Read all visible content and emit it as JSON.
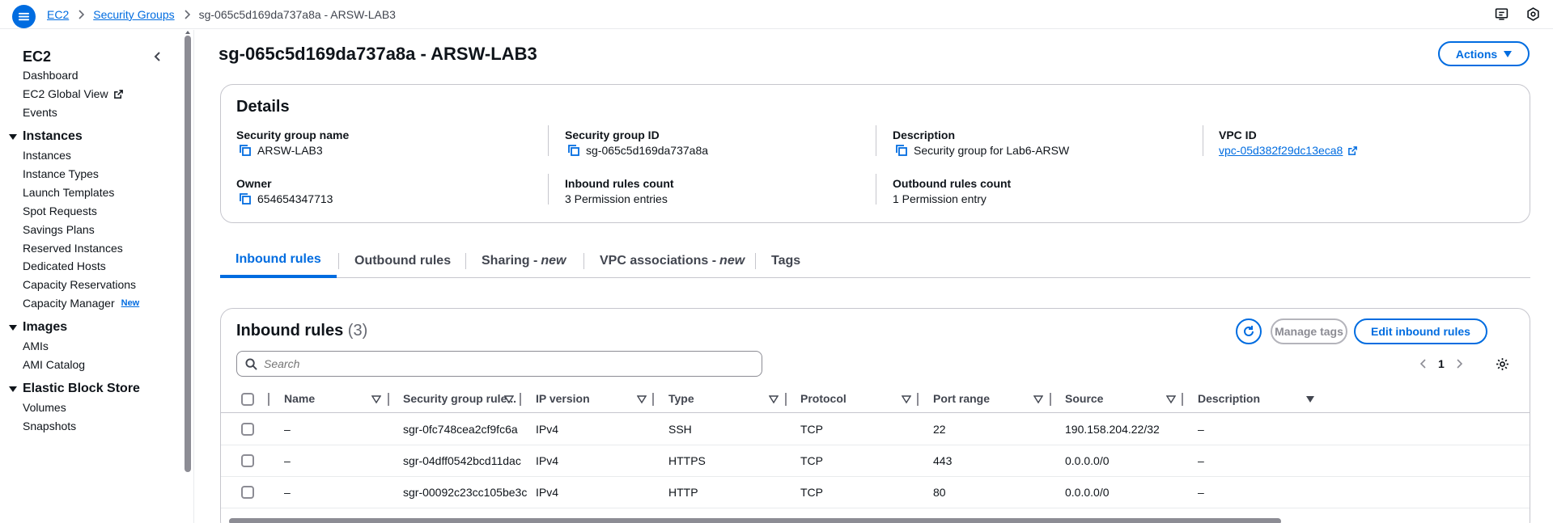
{
  "breadcrumb": {
    "root": "EC2",
    "parent": "Security Groups",
    "current": "sg-065c5d169da737a8a - ARSW-LAB3"
  },
  "sidebar": {
    "title": "EC2",
    "top_items": [
      "Dashboard",
      "EC2 Global View",
      "Events"
    ],
    "sections": [
      {
        "title": "Instances",
        "items": [
          "Instances",
          "Instance Types",
          "Launch Templates",
          "Spot Requests",
          "Savings Plans",
          "Reserved Instances",
          "Dedicated Hosts",
          "Capacity Reservations",
          "Capacity Manager"
        ]
      },
      {
        "title": "Images",
        "items": [
          "AMIs",
          "AMI Catalog"
        ]
      },
      {
        "title": "Elastic Block Store",
        "items": [
          "Volumes",
          "Snapshots"
        ]
      }
    ],
    "new_badge": "New"
  },
  "page": {
    "title": "sg-065c5d169da737a8a - ARSW-LAB3",
    "actions_label": "Actions"
  },
  "details": {
    "heading": "Details",
    "fields": {
      "sg_name": {
        "label": "Security group name",
        "value": "ARSW-LAB3"
      },
      "sg_id": {
        "label": "Security group ID",
        "value": "sg-065c5d169da737a8a"
      },
      "description": {
        "label": "Description",
        "value": "Security group for Lab6-ARSW"
      },
      "vpc_id": {
        "label": "VPC ID",
        "value": "vpc-05d382f29dc13eca8"
      },
      "owner": {
        "label": "Owner",
        "value": "654654347713"
      },
      "inbound_count": {
        "label": "Inbound rules count",
        "value": "3 Permission entries"
      },
      "outbound_count": {
        "label": "Outbound rules count",
        "value": "1 Permission entry"
      }
    }
  },
  "tabs": {
    "inbound": "Inbound rules",
    "outbound": "Outbound rules",
    "sharing": "Sharing -",
    "sharing_new": "new",
    "vpc_assoc": "VPC associations -",
    "vpc_assoc_new": "new",
    "tags": "Tags"
  },
  "rules": {
    "heading": "Inbound rules",
    "count": "(3)",
    "manage_tags": "Manage tags",
    "edit": "Edit inbound rules",
    "search_placeholder": "Search",
    "page": "1",
    "columns": [
      "Name",
      "Security group rule...",
      "IP version",
      "Type",
      "Protocol",
      "Port range",
      "Source",
      "Description"
    ],
    "rows": [
      {
        "name": "–",
        "rule_id": "sgr-0fc748cea2cf9fc6a",
        "ip_version": "IPv4",
        "type": "SSH",
        "protocol": "TCP",
        "port_range": "22",
        "source": "190.158.204.22/32",
        "description": "–"
      },
      {
        "name": "–",
        "rule_id": "sgr-04dff0542bcd11dac",
        "ip_version": "IPv4",
        "type": "HTTPS",
        "protocol": "TCP",
        "port_range": "443",
        "source": "0.0.0.0/0",
        "description": "–"
      },
      {
        "name": "–",
        "rule_id": "sgr-00092c23cc105be3c",
        "ip_version": "IPv4",
        "type": "HTTP",
        "protocol": "TCP",
        "port_range": "80",
        "source": "0.0.0.0/0",
        "description": "–"
      }
    ]
  },
  "colors": {
    "accent": "#006ce0",
    "text": "#0f141a",
    "border": "#c6c6cd"
  }
}
